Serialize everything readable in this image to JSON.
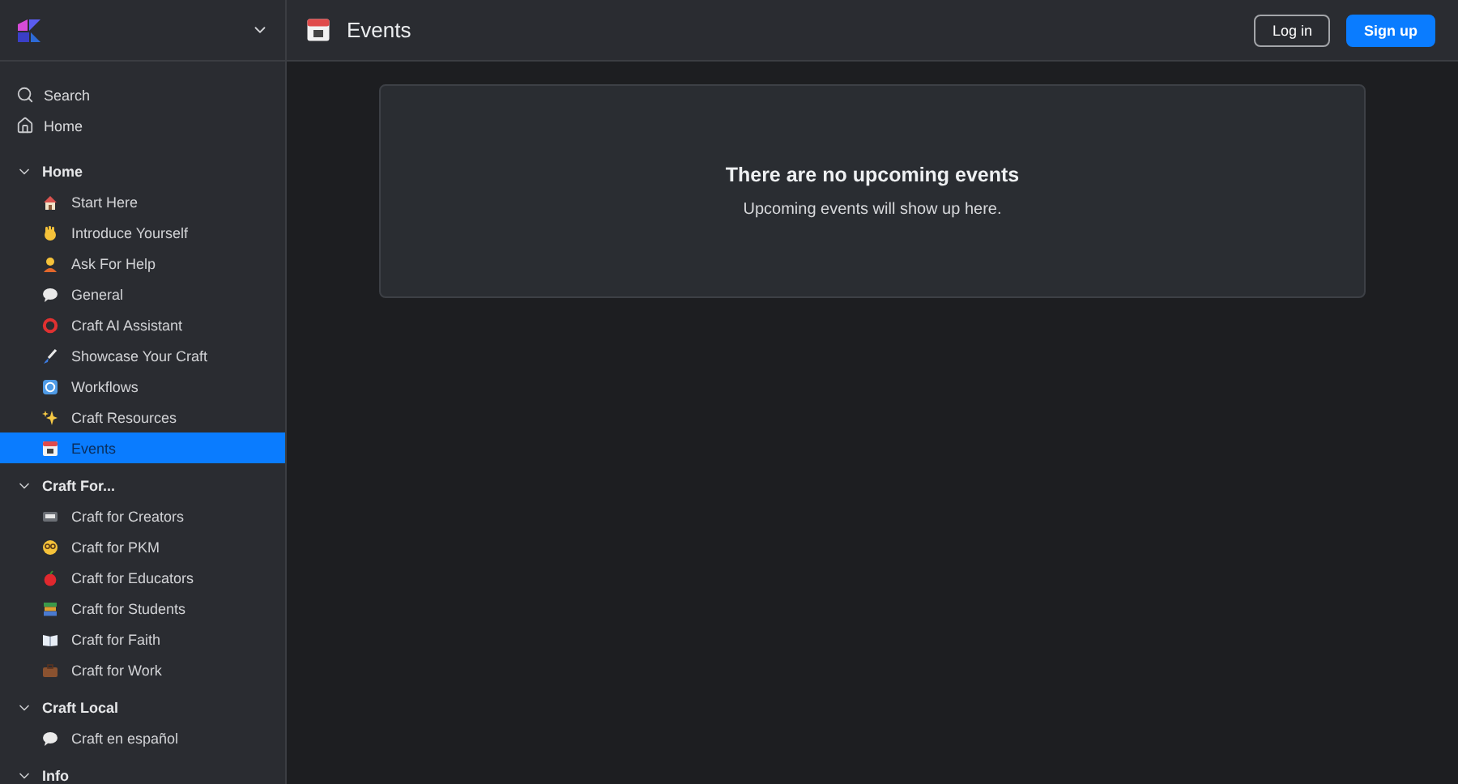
{
  "header": {
    "title": "Events",
    "buttons": [
      {
        "label": "Log in",
        "kind": "outline"
      },
      {
        "label": "Sign up",
        "kind": "primary"
      }
    ]
  },
  "sidebar": {
    "top_items": [
      {
        "label": "Search",
        "kind": "search"
      },
      {
        "label": "Home",
        "kind": "home"
      }
    ],
    "sections": [
      {
        "title": "Home",
        "expanded": true,
        "items": [
          {
            "kind": "house",
            "label": "Start Here",
            "selected": false
          },
          {
            "kind": "hand",
            "label": "Introduce Yourself",
            "selected": false
          },
          {
            "kind": "person",
            "label": "Ask For Help",
            "selected": false
          },
          {
            "kind": "speech",
            "label": "General",
            "selected": false
          },
          {
            "kind": "ring",
            "label": "Craft AI Assistant",
            "selected": false
          },
          {
            "kind": "brush",
            "label": "Showcase Your Craft",
            "selected": false
          },
          {
            "kind": "cycle",
            "label": "Workflows",
            "selected": false
          },
          {
            "kind": "sparkles",
            "label": "Craft Resources",
            "selected": false
          },
          {
            "kind": "calendar",
            "label": "Events",
            "selected": true
          }
        ]
      },
      {
        "title": "Craft For...",
        "expanded": true,
        "items": [
          {
            "kind": "tape",
            "label": "Craft for Creators",
            "selected": false
          },
          {
            "kind": "face",
            "label": "Craft for PKM",
            "selected": false
          },
          {
            "kind": "apple",
            "label": "Craft for Educators",
            "selected": false
          },
          {
            "kind": "books",
            "label": "Craft for Students",
            "selected": false
          },
          {
            "kind": "book",
            "label": "Craft for Faith",
            "selected": false
          },
          {
            "kind": "briefcase",
            "label": "Craft for Work",
            "selected": false
          }
        ]
      },
      {
        "title": "Craft Local",
        "expanded": true,
        "items": [
          {
            "kind": "speech",
            "label": "Craft en español",
            "selected": false
          }
        ]
      },
      {
        "title": "Info",
        "expanded": true
      }
    ]
  },
  "empty_state": {
    "title": "There are no upcoming events",
    "message": "Upcoming events will show up here."
  }
}
